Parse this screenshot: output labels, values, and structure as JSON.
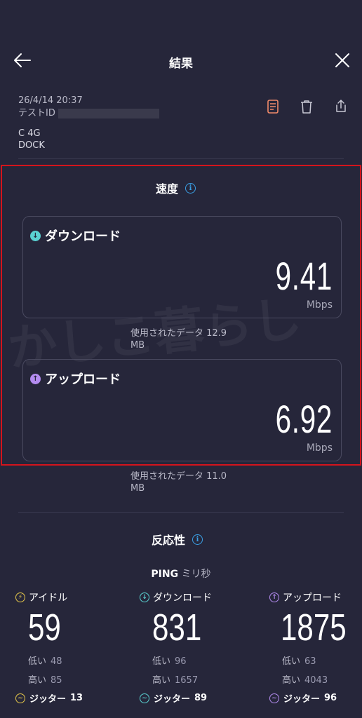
{
  "header": {
    "title": "結果",
    "back_icon": "back-arrow-icon",
    "close_icon": "close-icon"
  },
  "test_info": {
    "datetime": "26/4/14 20:37",
    "test_id_label": "テストID",
    "carrier": "C 4G",
    "device": "DOCK",
    "actions": [
      "document-icon",
      "trash-icon",
      "share-icon"
    ]
  },
  "speed": {
    "title": "速度",
    "download": {
      "label": "ダウンロード",
      "value": "9.41",
      "unit": "Mbps",
      "data_used": "使用されたデータ 12.9 MB"
    },
    "upload": {
      "label": "アップロード",
      "value": "6.92",
      "unit": "Mbps",
      "data_used": "使用されたデータ 11.0 MB"
    }
  },
  "watermark": "かしこ暮らし",
  "responsiveness": {
    "title": "反応性",
    "ping_label": "PING",
    "ping_unit": "ミリ秒",
    "columns": [
      {
        "label": "アイドル",
        "value": "59",
        "low_label": "低い",
        "low": "48",
        "high_label": "高い",
        "high": "85",
        "jitter_label": "ジッター",
        "jitter": "13",
        "color": "#e6c84a"
      },
      {
        "label": "ダウンロード",
        "value": "831",
        "low_label": "低い",
        "low": "96",
        "high_label": "高い",
        "high": "1657",
        "jitter_label": "ジッター",
        "jitter": "89",
        "color": "#5ad2d2"
      },
      {
        "label": "アップロード",
        "value": "1875",
        "low_label": "低い",
        "low": "63",
        "high_label": "高い",
        "high": "4043",
        "jitter_label": "ジッター",
        "jitter": "96",
        "color": "#b48cf0"
      }
    ]
  },
  "colors": {
    "background": "#26263a",
    "highlight_box": "#d4141c",
    "info": "#3aa0e6",
    "download": "#5ad2d2",
    "upload": "#b48cf0",
    "document_icon": "#f08a6a"
  }
}
